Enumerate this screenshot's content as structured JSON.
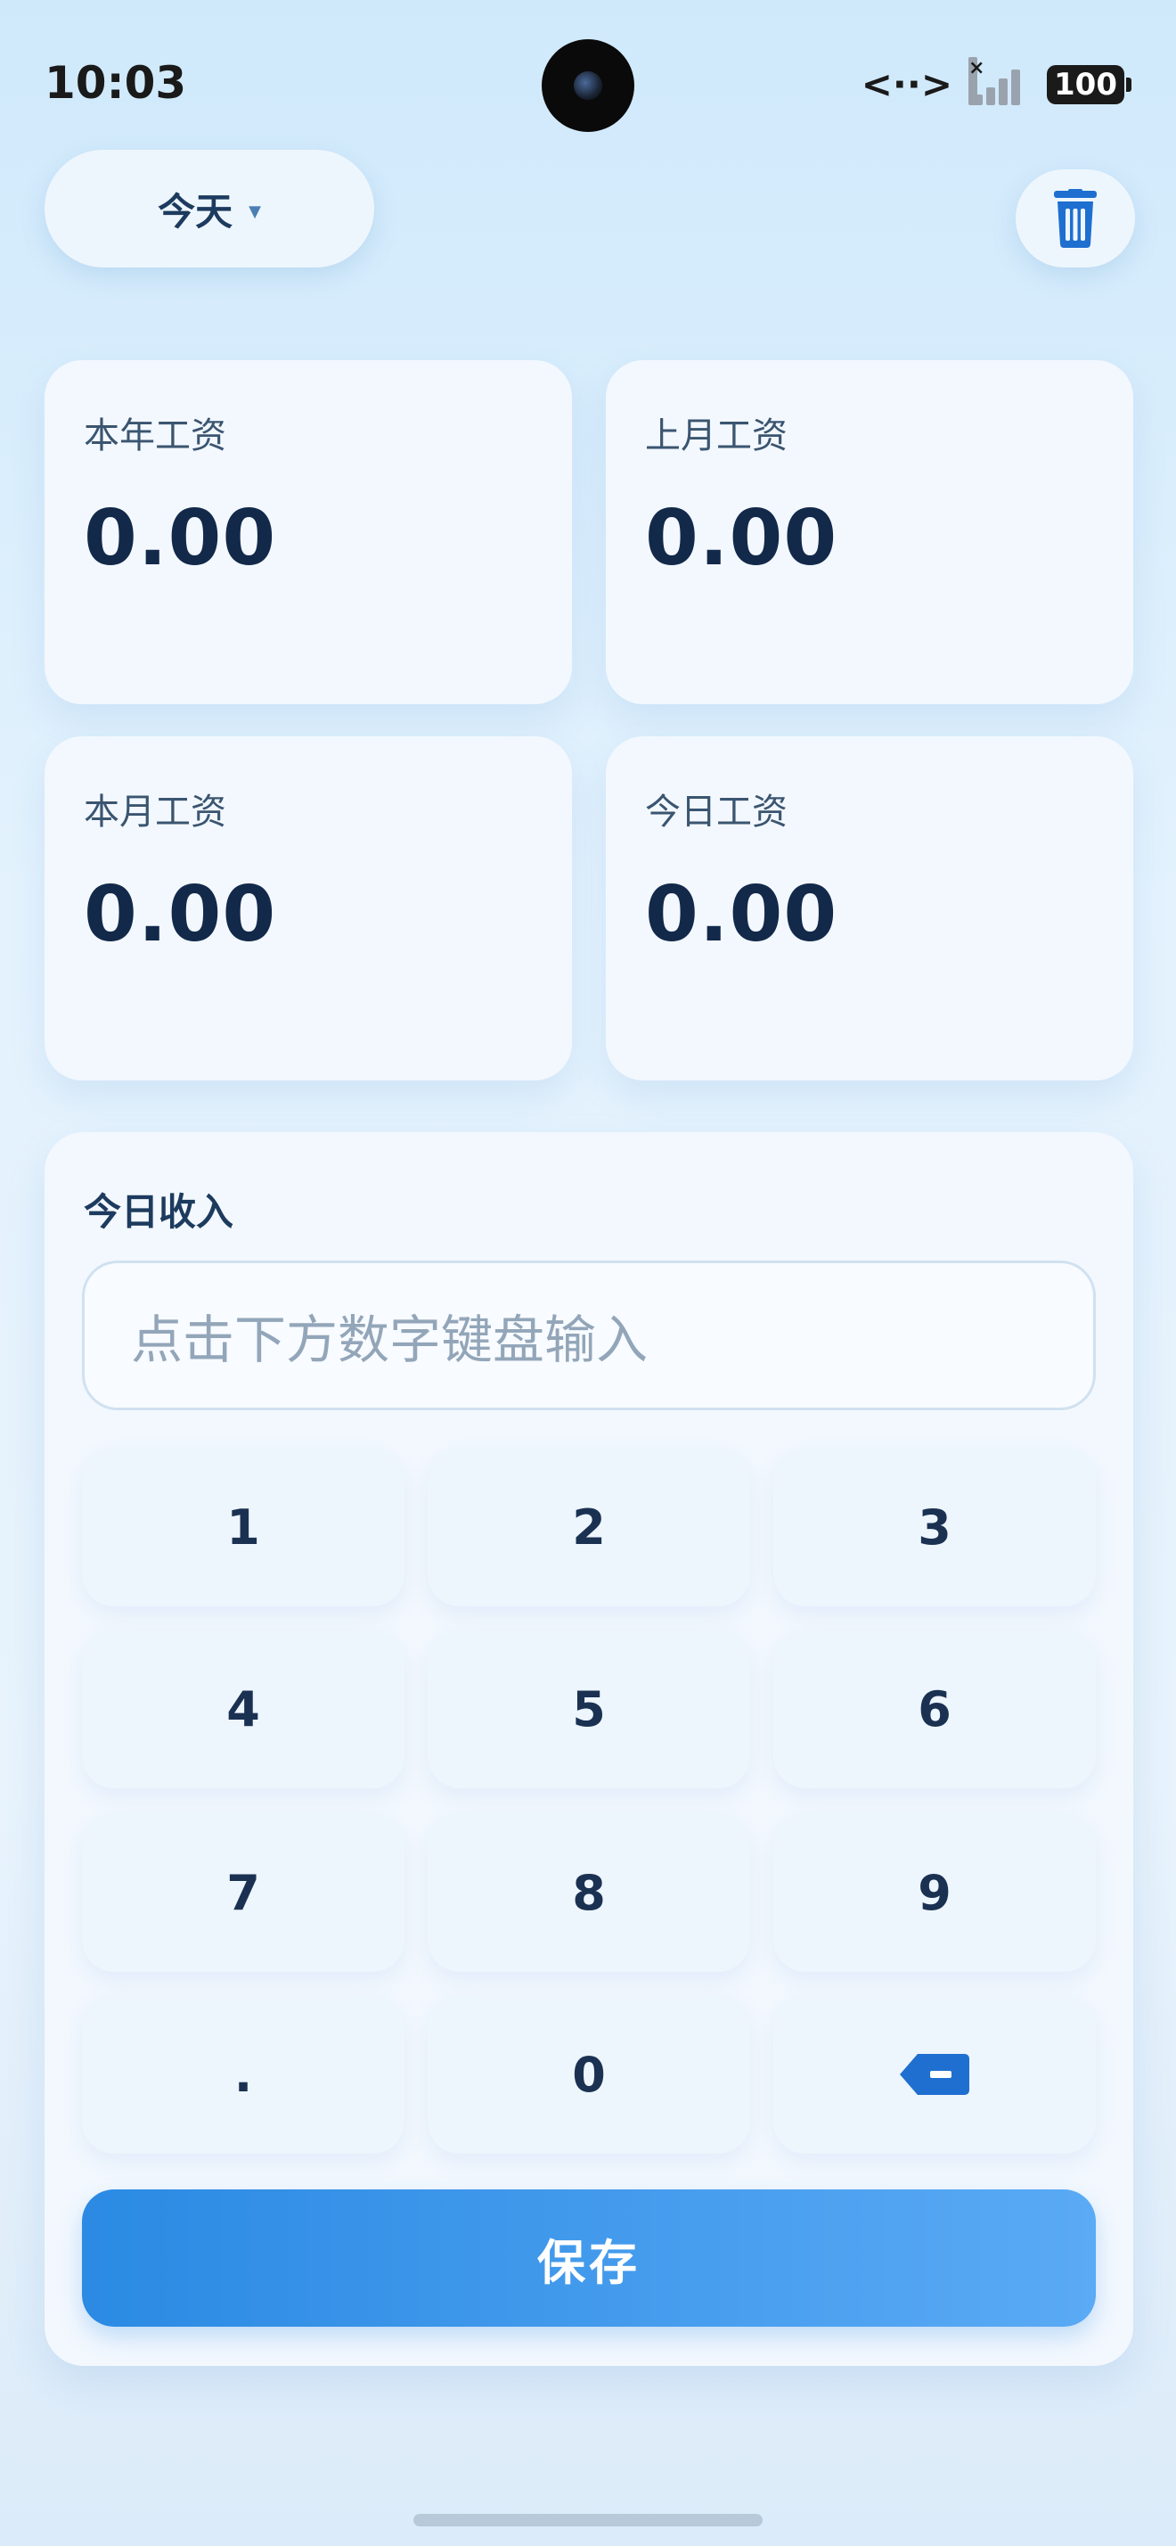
{
  "status_bar": {
    "time": "10:03",
    "battery": "100"
  },
  "header": {
    "date_filter_label": "今天",
    "delete_icon": "trash-icon"
  },
  "stats": {
    "year": {
      "label": "本年工资",
      "value": "0.00"
    },
    "last_month": {
      "label": "上月工资",
      "value": "0.00"
    },
    "month": {
      "label": "本月工资",
      "value": "0.00"
    },
    "today": {
      "label": "今日工资",
      "value": "0.00"
    }
  },
  "income": {
    "title": "今日收入",
    "placeholder": "点击下方数字键盘输入",
    "keys": [
      "1",
      "2",
      "3",
      "4",
      "5",
      "6",
      "7",
      "8",
      "9",
      ".",
      "0"
    ],
    "backspace_icon": "backspace-icon",
    "save_label": "保存"
  },
  "colors": {
    "accent": "#2b8ae3",
    "accent_light": "#5aaaf5",
    "text_dark": "#12294a",
    "card_bg": "#f3f8fe"
  }
}
